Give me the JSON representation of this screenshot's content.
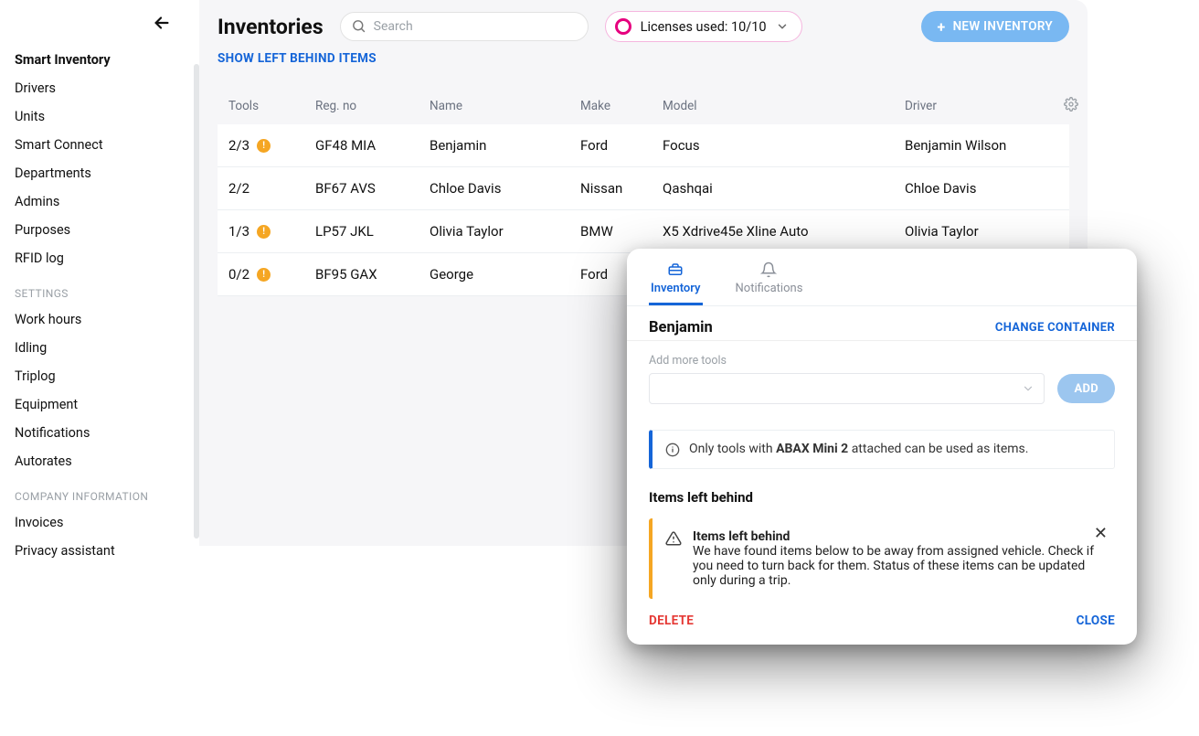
{
  "sidebar": {
    "items": [
      {
        "label": "Smart Inventory",
        "active": true
      },
      {
        "label": "Drivers"
      },
      {
        "label": "Units"
      },
      {
        "label": "Smart Connect"
      },
      {
        "label": "Departments"
      },
      {
        "label": "Admins"
      },
      {
        "label": "Purposes"
      },
      {
        "label": "RFID log"
      }
    ],
    "settings_label": "SETTINGS",
    "settings_items": [
      {
        "label": "Work hours"
      },
      {
        "label": "Idling"
      },
      {
        "label": "Triplog"
      },
      {
        "label": "Equipment"
      },
      {
        "label": "Notifications"
      },
      {
        "label": "Autorates"
      }
    ],
    "company_label": "COMPANY INFORMATION",
    "company_items": [
      {
        "label": "Invoices"
      },
      {
        "label": "Privacy assistant"
      }
    ]
  },
  "header": {
    "title": "Inventories",
    "search_placeholder": "Search",
    "licenses_text": "Licenses used: 10/10",
    "new_inventory_label": "NEW INVENTORY",
    "show_left_behind": "SHOW LEFT BEHIND ITEMS"
  },
  "table": {
    "columns": {
      "tools": "Tools",
      "reg": "Reg. no",
      "name": "Name",
      "make": "Make",
      "model": "Model",
      "driver": "Driver"
    },
    "rows": [
      {
        "tools": "2/3",
        "warn": true,
        "reg": "GF48 MIA",
        "name": "Benjamin",
        "make": "Ford",
        "model": "Focus",
        "driver": "Benjamin Wilson"
      },
      {
        "tools": "2/2",
        "warn": false,
        "reg": "BF67 AVS",
        "name": "Chloe Davis",
        "make": "Nissan",
        "model": "Qashqai",
        "driver": "Chloe Davis"
      },
      {
        "tools": "1/3",
        "warn": true,
        "reg": "LP57 JKL",
        "name": "Olivia Taylor",
        "make": "BMW",
        "model": "X5 Xdrive45e Xline Auto",
        "driver": "Olivia Taylor"
      },
      {
        "tools": "0/2",
        "warn": true,
        "reg": "BF95 GAX",
        "name": "George",
        "make": "Ford",
        "model": "",
        "driver": ""
      }
    ]
  },
  "panel": {
    "tabs": {
      "inventory": "Inventory",
      "notifications": "Notifications"
    },
    "name": "Benjamin",
    "change_container": "CHANGE CONTAINER",
    "add_more_label": "Add more tools",
    "add_button": "ADD",
    "info_prefix": "Only tools with ",
    "info_bold": "ABAX Mini 2",
    "info_suffix": " attached can be used as items.",
    "items_left_title": "Items left behind",
    "warn_title": "Items left behind",
    "warn_body": "We have found items below to be away from assigned vehicle. Check if you need to turn back for them. Status of these items can be updated only during a trip.",
    "delete": "DELETE",
    "close": "CLOSE"
  }
}
